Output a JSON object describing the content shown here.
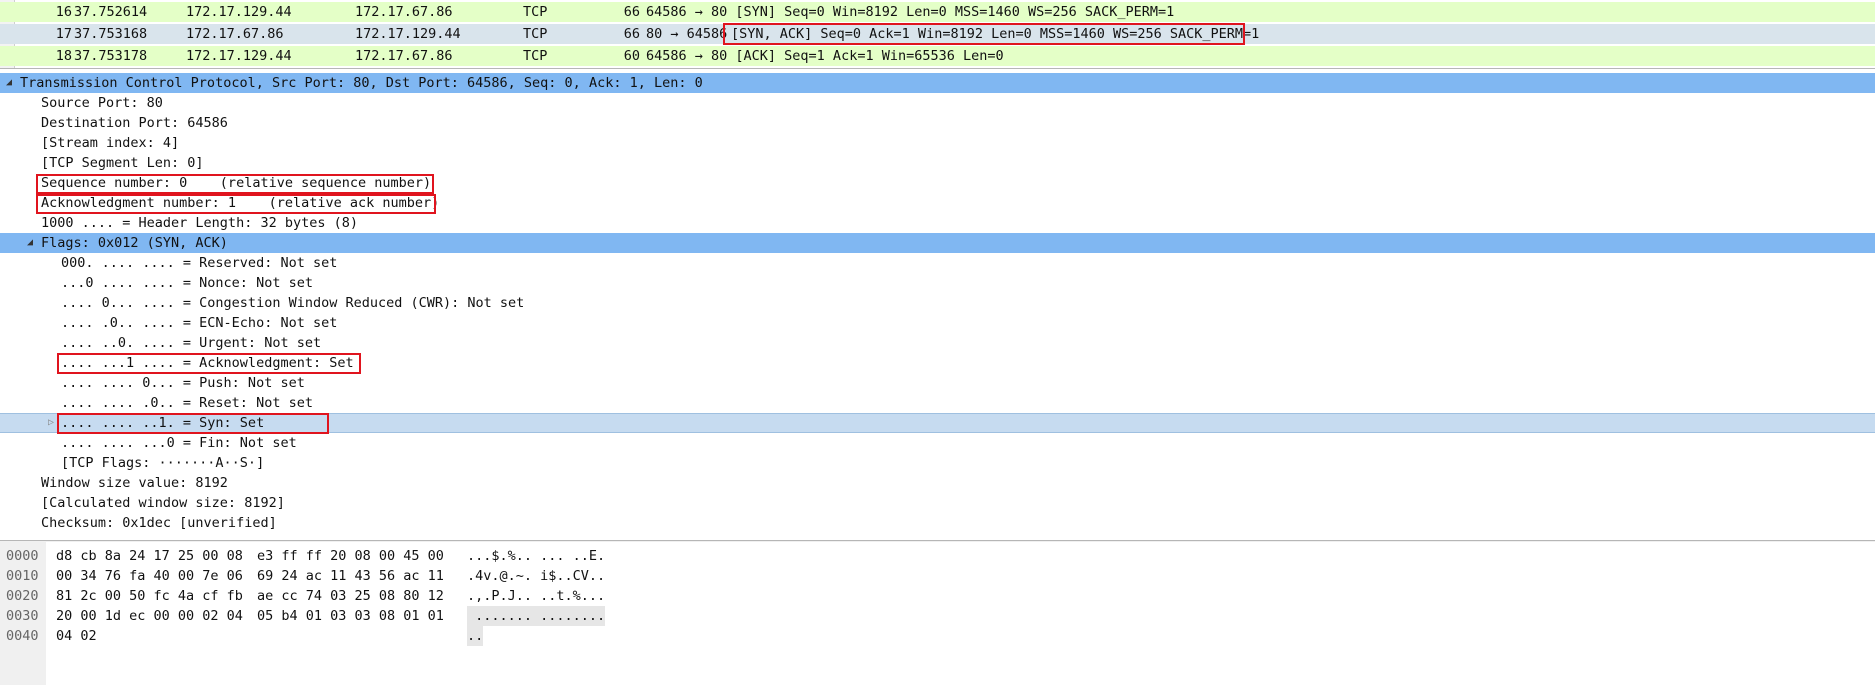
{
  "packets": [
    {
      "no": "16",
      "time": "37.752614",
      "src": "172.17.129.44",
      "dst": "172.17.67.86",
      "proto": "TCP",
      "len": "66",
      "info": "64586 → 80 [SYN] Seq=0 Win=8192 Len=0 MSS=1460 WS=256 SACK_PERM=1"
    },
    {
      "no": "17",
      "time": "37.753168",
      "src": "172.17.67.86",
      "dst": "172.17.129.44",
      "proto": "TCP",
      "len": "66",
      "info_prefix": "80 → 64586 ",
      "info": "[SYN, ACK] Seq=0 Ack=1 Win=8192 Len=0 MSS=1460 WS=256 SACK_PERM=1"
    },
    {
      "no": "18",
      "time": "37.753178",
      "src": "172.17.129.44",
      "dst": "172.17.67.86",
      "proto": "TCP",
      "len": "60",
      "info": "64586 → 80 [ACK] Seq=1 Ack=1 Win=65536 Len=0"
    }
  ],
  "details": {
    "header": "Transmission Control Protocol, Src Port: 80, Dst Port: 64586, Seq: 0, Ack: 1, Len: 0",
    "source_port": "Source Port: 80",
    "dest_port": "Destination Port: 64586",
    "stream_index": "[Stream index: 4]",
    "segment_len": "[TCP Segment Len: 0]",
    "seq_number": "Sequence number: 0    (relative sequence number)",
    "ack_number": "Acknowledgment number: 1    (relative ack number)",
    "header_length": "1000 .... = Header Length: 32 bytes (8)",
    "flags": "Flags: 0x012 (SYN, ACK)",
    "flag_reserved": "000. .... .... = Reserved: Not set",
    "flag_nonce": "...0 .... .... = Nonce: Not set",
    "flag_cwr": ".... 0... .... = Congestion Window Reduced (CWR): Not set",
    "flag_ecn": ".... .0.. .... = ECN-Echo: Not set",
    "flag_urgent": ".... ..0. .... = Urgent: Not set",
    "flag_ack": ".... ...1 .... = Acknowledgment: Set",
    "flag_push": ".... .... 0... = Push: Not set",
    "flag_reset": ".... .... .0.. = Reset: Not set",
    "flag_syn": ".... .... ..1. = Syn: Set",
    "flag_fin": ".... .... ...0 = Fin: Not set",
    "tcp_flags": "[TCP Flags: ·······A··S·]",
    "window_size": "Window size value: 8192",
    "calc_window": "[Calculated window size: 8192]",
    "checksum": "Checksum: 0x1dec [unverified]"
  },
  "bytes": [
    {
      "offset": "0000",
      "hex1": "d8 cb 8a 24 17 25 00 08",
      "hex2": "e3 ff ff 20 08 00 45 00",
      "ascii": "...$.%.. ... ..E."
    },
    {
      "offset": "0010",
      "hex1": "00 34 76 fa 40 00 7e 06",
      "hex2": "69 24 ac 11 43 56 ac 11",
      "ascii": ".4v.@.~. i$..CV.."
    },
    {
      "offset": "0020",
      "hex1": "81 2c 00 50 fc 4a cf fb",
      "hex2": "ae cc 74 03 25 08 80 12",
      "ascii": ".,.P.J.. ..t.%..."
    },
    {
      "offset": "0030",
      "hex1": "20 00 1d ec 00 00 02 04",
      "hex2": "05 b4 01 03 03 08 01 01",
      "ascii": " ....... ........"
    },
    {
      "offset": "0040",
      "hex1": "04 02",
      "hex2": "",
      "ascii": ".."
    }
  ],
  "icons": {
    "collapse": "triangle-down",
    "expand": "triangle-right"
  },
  "colors": {
    "packet_row_bg": "#e4ffc7",
    "selected_tree_bg": "#80b7f2",
    "annotation_red": "#e0141e"
  }
}
